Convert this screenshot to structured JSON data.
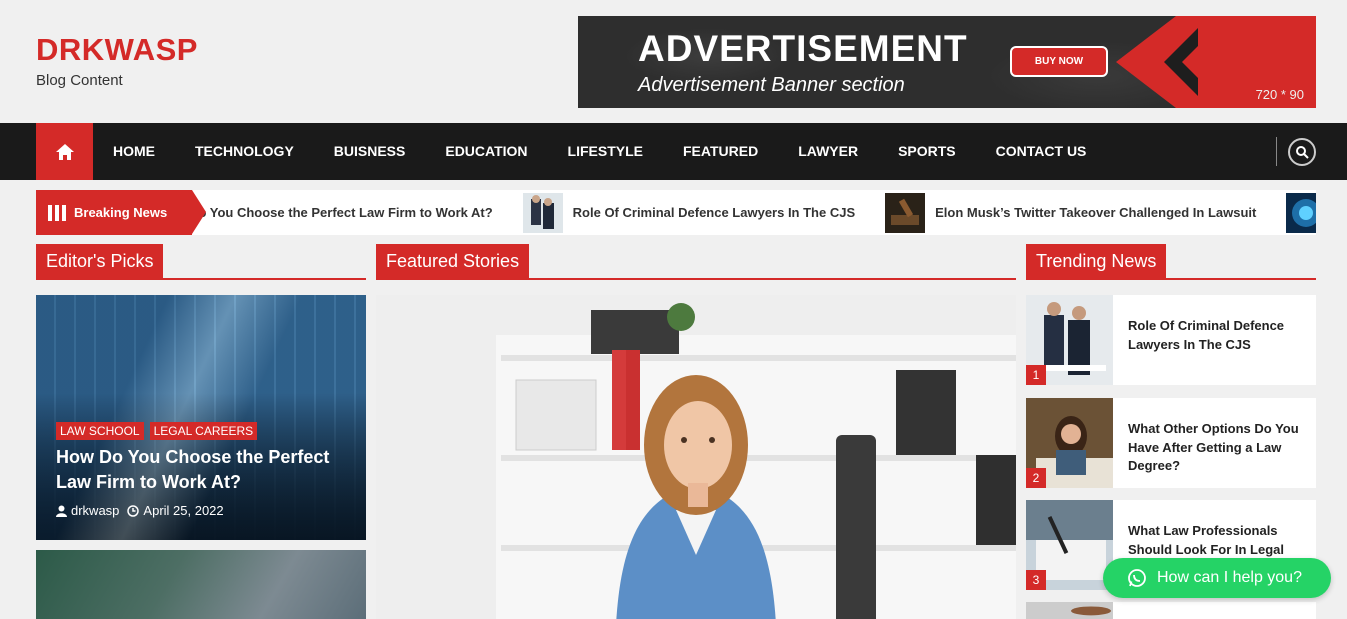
{
  "site": {
    "title": "DRKWASP",
    "tagline": "Blog Content"
  },
  "ad": {
    "title": "ADVERTISEMENT",
    "subtitle": "Advertisement Banner section",
    "button": "BUY NOW",
    "size": "720 * 90"
  },
  "nav": {
    "items": [
      "HOME",
      "TECHNOLOGY",
      "BUISNESS",
      "EDUCATION",
      "LIFESTYLE",
      "FEATURED",
      "LAWYER",
      "SPORTS",
      "CONTACT US"
    ]
  },
  "ticker": {
    "label": "Breaking News",
    "items": [
      "How Do You Choose the Perfect Law Firm to Work At?",
      "Role Of Criminal Defence Lawyers In The CJS",
      "Elon Musk’s Twitter Takeover Challenged In Lawsuit"
    ]
  },
  "sections": {
    "editors": "Editor's Picks",
    "featured": "Featured Stories",
    "trending": "Trending News"
  },
  "pick": {
    "tags": [
      "LAW SCHOOL",
      "LEGAL CAREERS"
    ],
    "title": "How Do You Choose the Perfect Law Firm to Work At?",
    "author": "drkwasp",
    "date": "April 25, 2022"
  },
  "trending": [
    {
      "num": "1",
      "title": "Role Of Criminal Defence Lawyers In The CJS"
    },
    {
      "num": "2",
      "title": "What Other Options Do You Have After Getting a Law Degree?"
    },
    {
      "num": "3",
      "title": "What Law Professionals Should Look For In Legal Consultancy Firms"
    }
  ],
  "chat": {
    "label": "How can I help you?"
  },
  "colors": {
    "accent": "#d42a28",
    "nav_bg": "#1a1a1a",
    "chat": "#25d366"
  }
}
